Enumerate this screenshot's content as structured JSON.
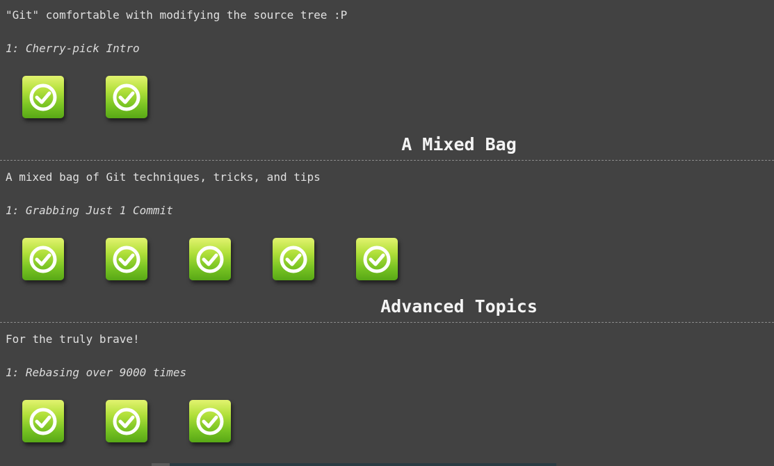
{
  "sections": [
    {
      "description": "\"Git\" comfortable with modifying the source tree :P",
      "level_label": "1: Cherry-pick Intro",
      "icons": [
        {
          "name": "check-icon",
          "status": "completed"
        },
        {
          "name": "check-icon",
          "status": "completed"
        }
      ]
    },
    {
      "title": "A Mixed Bag",
      "description": "A mixed bag of Git techniques, tricks, and tips",
      "level_label": "1: Grabbing Just 1 Commit",
      "icons": [
        {
          "name": "check-icon",
          "status": "completed"
        },
        {
          "name": "check-icon",
          "status": "completed"
        },
        {
          "name": "check-icon",
          "status": "completed"
        },
        {
          "name": "check-icon",
          "status": "completed"
        },
        {
          "name": "check-icon",
          "status": "completed"
        }
      ]
    },
    {
      "title": "Advanced Topics",
      "description": "For the truly brave!",
      "level_label": "1: Rebasing over 9000 times",
      "icons": [
        {
          "name": "check-icon",
          "status": "completed"
        },
        {
          "name": "check-icon",
          "status": "completed"
        },
        {
          "name": "check-icon",
          "status": "completed"
        }
      ]
    }
  ],
  "colors": {
    "background": "#424242",
    "text": "#e0e0e0",
    "icon_top": "#e2f36f",
    "icon_bottom": "#58a816",
    "check": "#ffffff"
  }
}
